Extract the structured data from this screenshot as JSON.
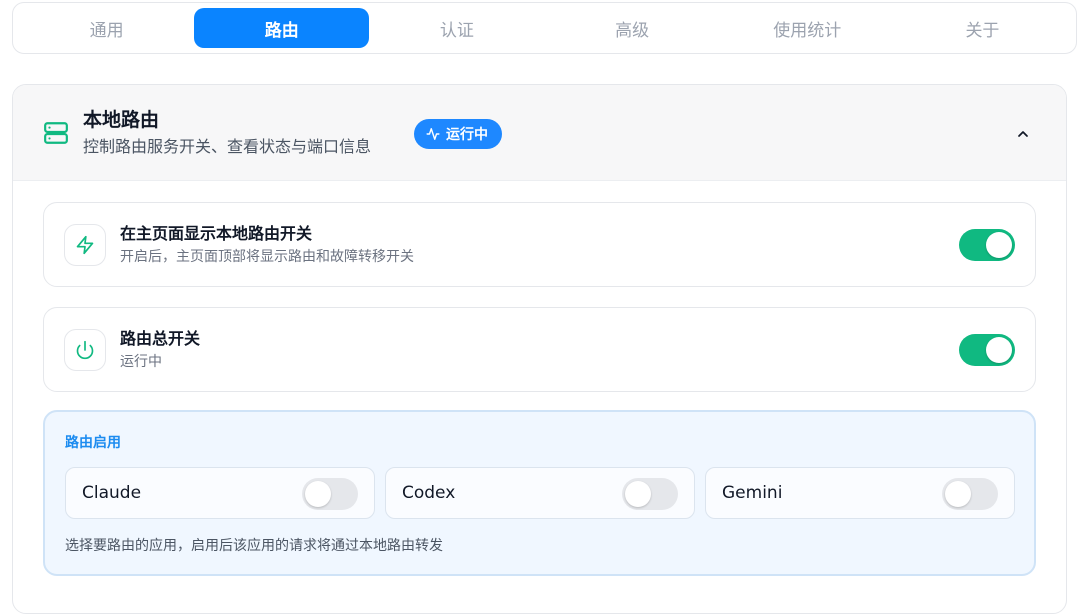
{
  "tabs": [
    {
      "label": "通用",
      "active": false
    },
    {
      "label": "路由",
      "active": true
    },
    {
      "label": "认证",
      "active": false
    },
    {
      "label": "高级",
      "active": false
    },
    {
      "label": "使用统计",
      "active": false
    },
    {
      "label": "关于",
      "active": false
    }
  ],
  "panel": {
    "title": "本地路由",
    "subtitle": "控制路由服务开关、查看状态与端口信息",
    "status_label": "运行中",
    "icon": "server-icon",
    "collapse_icon": "chevron-up-icon"
  },
  "settings": [
    {
      "title": "在主页面显示本地路由开关",
      "desc": "开启后，主页面顶部将显示路由和故障转移开关",
      "icon": "lightning-icon",
      "enabled": true
    },
    {
      "title": "路由总开关",
      "desc": "运行中",
      "icon": "power-icon",
      "enabled": true
    }
  ],
  "routing": {
    "title": "路由启用",
    "apps": [
      {
        "name": "Claude",
        "enabled": false
      },
      {
        "name": "Codex",
        "enabled": false
      },
      {
        "name": "Gemini",
        "enabled": false
      }
    ],
    "hint": "选择要路由的应用，启用后该应用的请求将通过本地路由转发"
  },
  "colors": {
    "accent": "#0a84ff",
    "toggle_on": "#10b981",
    "icon_green": "#10b981"
  }
}
